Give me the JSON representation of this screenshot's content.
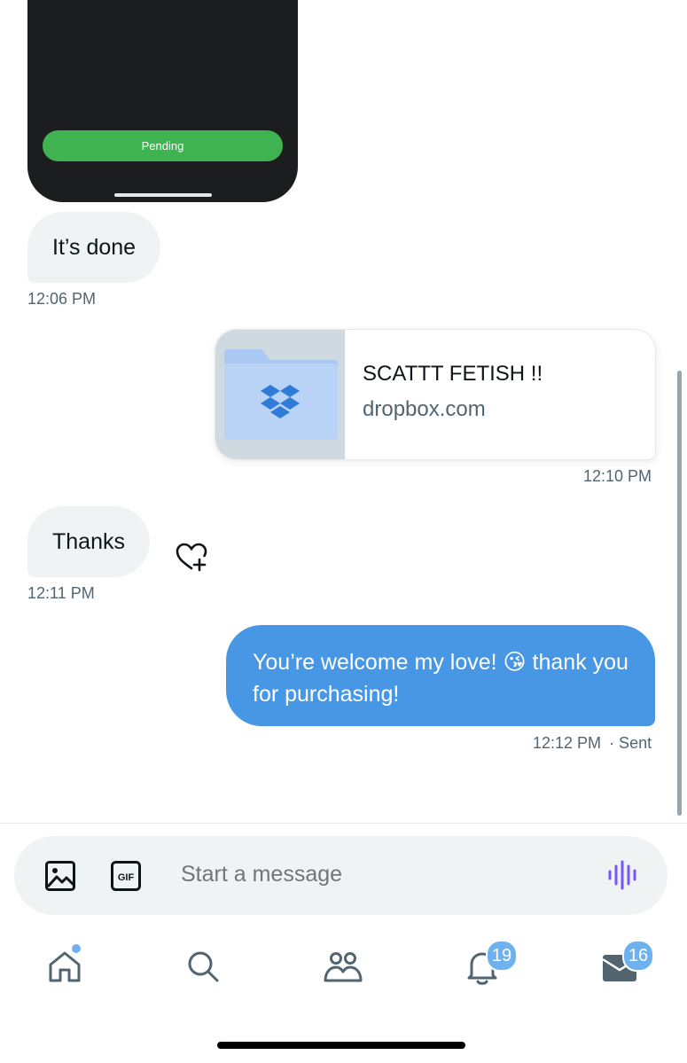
{
  "media_preview": {
    "status_button": "Pending"
  },
  "messages": [
    {
      "direction": "received",
      "text": "It’s done",
      "time": "12:06 PM"
    },
    {
      "direction": "sent",
      "type": "link",
      "title": "SCATTT FETISH !!",
      "domain": "dropbox.com",
      "time": "12:10 PM"
    },
    {
      "direction": "received",
      "text": "Thanks",
      "time": "12:11 PM"
    },
    {
      "direction": "sent",
      "text": "You’re welcome my love! 😘 thank you for purchasing!",
      "time": "12:12 PM",
      "status": "· Sent"
    }
  ],
  "composer": {
    "placeholder": "Start a message",
    "gif_label": "GIF"
  },
  "nav": {
    "notifications_count": "19",
    "messages_count": "16"
  },
  "colors": {
    "sent_bubble": "#4897e5",
    "received_bubble": "#eff3f4",
    "pending_green": "#3fb34f",
    "badge": "#6eb1ee",
    "voice_icon": "#7856ff"
  }
}
